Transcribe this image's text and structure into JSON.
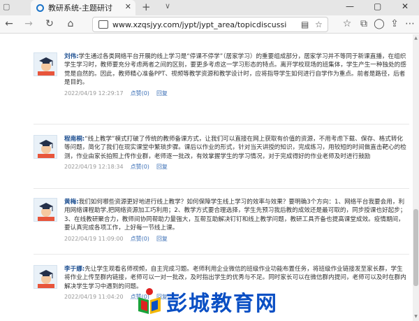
{
  "browser": {
    "tab_title": "教研系统-主题研讨",
    "tab_close": "✕",
    "new_tab": "+",
    "tab_dropdown": "∨",
    "url": "www.xzqsjyy.com/jypt/jypt_area/topicdiscussion_handlePage"
  },
  "comments": [
    {
      "author": "刘伟:",
      "text": "学生通过各类网络平台开展的线上学习是“停课不停学”（居家学习）的重要组成部分，居家学习并不等同于新课直播，在组织学生学习时，教师要充分考虑两者之间的区别，要更多考虑这一学习形态的特点。离开学校现场的班集体，学生产生一种独处的感觉是自然的。因此，教师精心准备PPT、视频等教学资源和教学设计时，应将指导学生如何进行自学作为重点。前者是路径，后者是目的。",
      "time": "2022/04/19 12:29:17",
      "like": "点赞(0)",
      "reply": "回复"
    },
    {
      "author": "程南桐:",
      "text": "“线上教学”模式打破了传统的教师备课方式，让我们可以直接在网上获取有价值的资源，不用考虑下载、保存、格式转化等问题，简化了我们在现实课堂中繁琐步骤。课后以作业的形式，针对当天讲授的知识，完成练习，用较短的时间做直击靶心的检测，作业由家长拍照上传作业群，老师逐一批改，有效掌握学生的学习情况，对于完成得好的作业老师及时进行鼓励",
      "time": "2022/04/19 12:18:34",
      "like": "点赞(0)",
      "reply": "回复"
    },
    {
      "author": "黄梅:",
      "text": "我们如何哪些资源更好地进行线上教学？如何保障学生线上学习的效率与效果？要明确3个方向：1、网络平台我要会用，利用网络课程助学,把网络资源加工巧利用；2、教学方式要合理选择，学生先预习我后教的成效还是最可取的，同步授课也好起步；3、在线教研聚合力，教师间协同帮助力量强大，互帮互助解决钉钉和线上教学问题，教研工具齐备也提高课堂成效。疫情期间，要认真完成各项工作，上好每一节线上课。",
      "time": "2022/04/19 11:09:00",
      "like": "点赞(0)",
      "reply": "回复"
    },
    {
      "author": "李于娜:",
      "text": "先让学生观看名师视频，自主完成习题。老师利用企业微信的班级作业功能布置任务，将班级作业链接发至家长群，学生将作业上传至群内链接，老师可以一对一批改，及时指出学生的优秀与不足。同时家长可以在微信群内提问，老师可以及时在群内解决学生学习中遇到的问题。",
      "time": "2022/04/19 11:04:20",
      "like": "点赞(0)",
      "reply": "回复"
    }
  ],
  "watermark": "彭城教育网",
  "colors": {
    "author": "#1d4f91",
    "link": "#3b6fb6",
    "watermark": "#0a4fc4"
  }
}
